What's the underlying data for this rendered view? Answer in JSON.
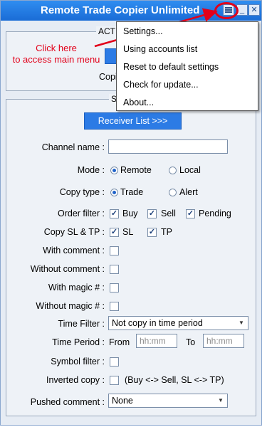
{
  "window": {
    "title": "Remote Trade Copier Unlimited",
    "buttons": {
      "menu": "menu",
      "minimize": "_",
      "close": "✕"
    }
  },
  "annotation": {
    "line1": "Click here",
    "line2": "to access main menu"
  },
  "top_group": {
    "label_partial": "ACTI",
    "copier_partial": "Copie"
  },
  "settings_group": {
    "label_partial": "S",
    "receiver_button": "Receiver List >>>"
  },
  "context_menu": {
    "items": [
      "Settings...",
      "Using accounts list",
      "Reset to default settings",
      "Check for update...",
      "About..."
    ]
  },
  "form": {
    "channel_name": {
      "label": "Channel name :",
      "value": ""
    },
    "mode": {
      "label": "Mode :",
      "options": [
        "Remote",
        "Local"
      ],
      "selected": "Remote"
    },
    "copy_type": {
      "label": "Copy type :",
      "options": [
        "Trade",
        "Alert"
      ],
      "selected": "Trade"
    },
    "order_filter": {
      "label": "Order filter :",
      "items": [
        {
          "label": "Buy",
          "checked": true
        },
        {
          "label": "Sell",
          "checked": true
        },
        {
          "label": "Pending",
          "checked": true
        }
      ]
    },
    "copy_sl_tp": {
      "label": "Copy SL & TP :",
      "items": [
        {
          "label": "SL",
          "checked": true
        },
        {
          "label": "TP",
          "checked": true
        }
      ]
    },
    "with_comment": {
      "label": "With comment :",
      "checked": false
    },
    "without_comment": {
      "label": "Without comment :",
      "checked": false
    },
    "with_magic": {
      "label": "With magic # :",
      "checked": false
    },
    "without_magic": {
      "label": "Without magic # :",
      "checked": false
    },
    "time_filter": {
      "label": "Time Filter :",
      "value": "Not copy in time period"
    },
    "time_period": {
      "label": "Time Period :",
      "from_label": "From",
      "from_placeholder": "hh:mm",
      "to_label": "To",
      "to_placeholder": "hh:mm"
    },
    "symbol_filter": {
      "label": "Symbol filter :",
      "checked": false
    },
    "inverted_copy": {
      "label": "Inverted copy :",
      "checked": false,
      "note": "(Buy <-> Sell, SL <-> TP)"
    },
    "pushed_comment": {
      "label": "Pushed comment :",
      "value": "None"
    }
  },
  "colors": {
    "titlebar": "#1a6cd6",
    "accent_button": "#2c7be5",
    "annotation": "#e2001a"
  },
  "icons": {
    "menu": "menu-icon",
    "minimize": "minimize-icon",
    "close": "close-icon",
    "dropdown": "chevron-down-icon"
  }
}
